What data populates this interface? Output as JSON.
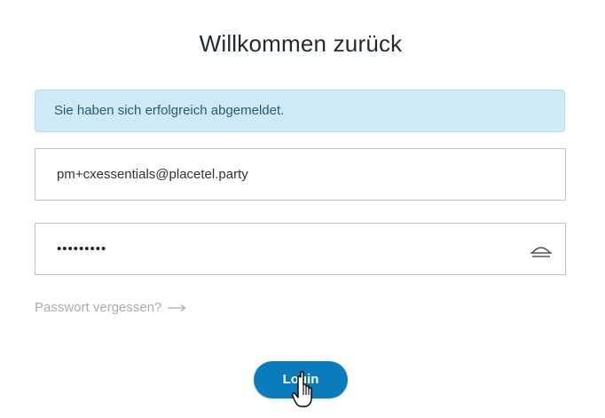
{
  "page": {
    "title": "Willkommen zurück"
  },
  "alert": {
    "message": "Sie haben sich erfolgreich abgemeldet."
  },
  "email_field": {
    "value": "pm+cxessentials@placetel.party"
  },
  "password_field": {
    "value": "•••••••••"
  },
  "forgot_link": {
    "label": "Passwort vergessen?",
    "icon": "arrow-right-icon"
  },
  "login_button": {
    "label": "Login",
    "color": "#0a7bbd"
  },
  "icons": {
    "password_toggle": "eye-closed-icon",
    "cursor": "hand-pointer-icon"
  },
  "colors": {
    "alert_bg": "#cfeaf7",
    "alert_text": "#245c78",
    "link_muted": "#a6adb2"
  }
}
